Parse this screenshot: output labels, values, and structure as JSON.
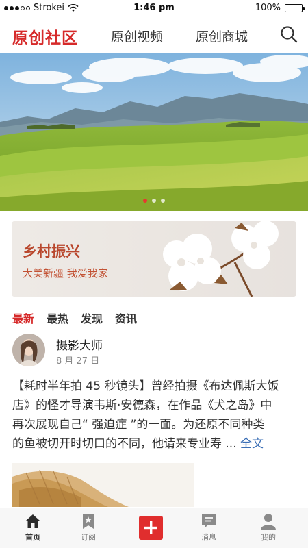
{
  "status_bar": {
    "carrier": "Strokei",
    "time": "1:46 pm",
    "battery": "100%"
  },
  "top_nav": {
    "brand": "原创社区",
    "tabs": [
      {
        "label": "原创视频"
      },
      {
        "label": "原创商城"
      }
    ],
    "search_icon": "search-icon"
  },
  "banner": {
    "slide_count": 3,
    "active_slide": 1
  },
  "promo": {
    "title": "乡村振兴",
    "subtitle": "大美新疆 我爱我家"
  },
  "feed_tabs": [
    {
      "label": "最新",
      "active": true
    },
    {
      "label": "最热",
      "active": false
    },
    {
      "label": "发现",
      "active": false
    },
    {
      "label": "资讯",
      "active": false
    }
  ],
  "post": {
    "author": "摄影大师",
    "date": "8 月 27 日",
    "lines": [
      "【耗时半年拍 45 秒镜头】曾经拍摄《布达佩斯大饭",
      "店》的怪才导演韦斯·安德森，在作品《犬之岛》中",
      "再次展现自己“ 强迫症 ”的一面。为还原不同种类",
      "的鱼被切开时切口的不同，他请来专业寿"
    ],
    "ellipsis": "...",
    "read_more": "全文"
  },
  "tab_bar": {
    "items": [
      {
        "label": "首页",
        "icon": "home-icon",
        "active": true
      },
      {
        "label": "订阅",
        "icon": "bookmark-star-icon",
        "active": false
      },
      {
        "label": "消息",
        "icon": "message-icon",
        "active": false
      },
      {
        "label": "我的",
        "icon": "person-icon",
        "active": false
      }
    ],
    "publish_icon": "plus-icon"
  },
  "colors": {
    "brand_red": "#d62a2a",
    "link_blue": "#3b6fb6",
    "promo_text": "#b9482e"
  }
}
